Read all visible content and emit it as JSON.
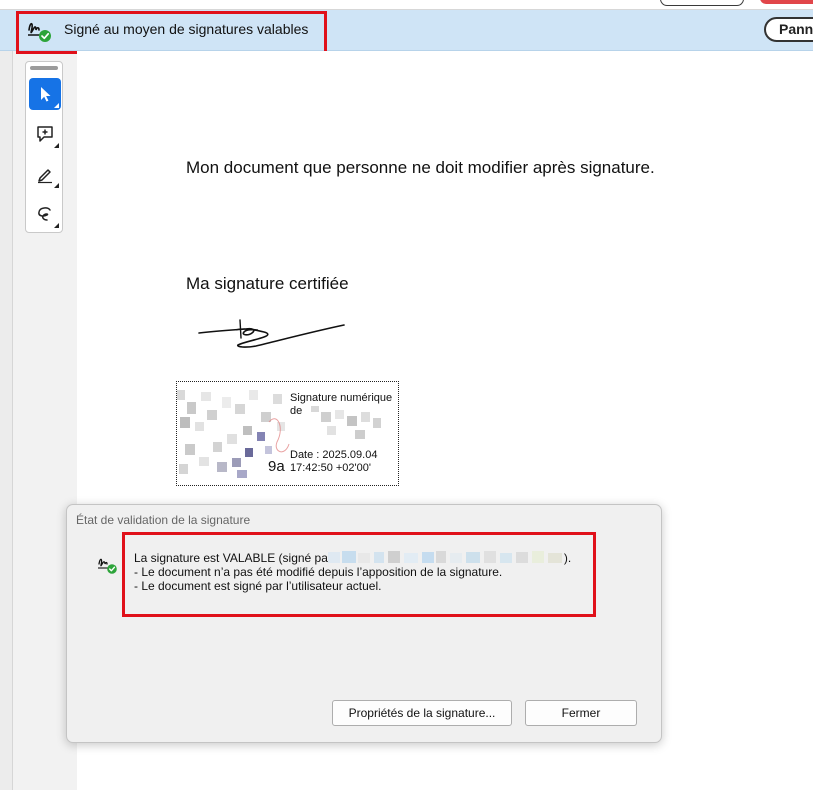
{
  "banner": {
    "status_text": "Signé au moyen de signatures valables",
    "panel_button_label": "Panneau"
  },
  "toolbar": {
    "tools": [
      {
        "name": "select-tool",
        "icon": "cursor-arrow-icon",
        "active": true
      },
      {
        "name": "comment-tool",
        "icon": "add-comment-icon",
        "active": false
      },
      {
        "name": "highlight-tool",
        "icon": "pen-icon",
        "active": false
      },
      {
        "name": "draw-tool",
        "icon": "lasso-icon",
        "active": false
      }
    ]
  },
  "document": {
    "line1": "Mon document que personne ne doit modifier après signature.",
    "line2": "Ma signature certifiée",
    "stamp": {
      "title": "Signature numérique",
      "de": "de",
      "partial_id": "9a",
      "date_line": "Date : 2025.09.04",
      "time_line": "17:42:50 +02'00'"
    }
  },
  "dialog": {
    "title": "État de validation de la signature",
    "message_prefix": "La signature est VALABLE (signé pa",
    "message_suffix": ").",
    "detail_1": "- Le document n’a pas été modifié depuis l’apposition de la signature.",
    "detail_2": "- Le document est signé par l’utilisateur actuel.",
    "properties_button": "Propriétés de la signature...",
    "close_button": "Fermer"
  },
  "colors": {
    "banner_bg": "#cfe4f6",
    "highlight_red": "#e0101a",
    "tool_active": "#1673e6",
    "valid_green": "#2da43a"
  }
}
